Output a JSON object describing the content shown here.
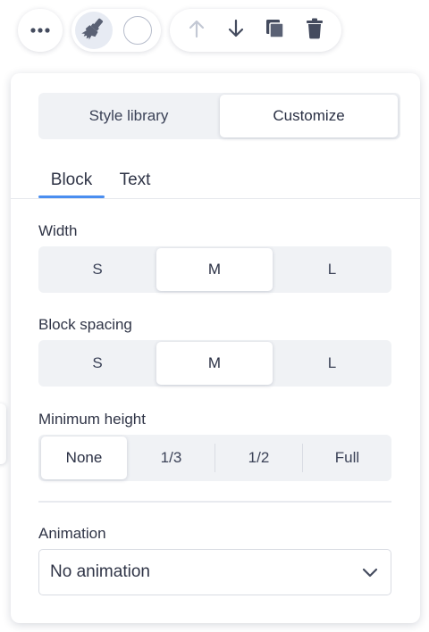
{
  "toolbar": {
    "more_icon": "more-horizontal-icon",
    "style_icon": "paintbrush-icon",
    "color_icon": "color-circle",
    "actions": [
      "arrow-up-icon",
      "arrow-down-icon",
      "duplicate-icon",
      "trash-icon"
    ]
  },
  "panel": {
    "mode_toggle": {
      "style_library": "Style library",
      "customize": "Customize",
      "selected": "Customize"
    },
    "tabs": {
      "block": "Block",
      "text": "Text",
      "active": "Block"
    },
    "width": {
      "label": "Width",
      "options": [
        "S",
        "M",
        "L"
      ],
      "selected": "M"
    },
    "block_spacing": {
      "label": "Block spacing",
      "options": [
        "S",
        "M",
        "L"
      ],
      "selected": "M"
    },
    "minimum_height": {
      "label": "Minimum height",
      "options": [
        "None",
        "1/3",
        "1/2",
        "Full"
      ],
      "selected": "None"
    },
    "animation": {
      "label": "Animation",
      "value": "No animation"
    }
  },
  "colors": {
    "accent": "#4a8ef0",
    "panel_bg": "#ffffff",
    "segment_bg": "#f0f2f5",
    "text": "#2f3446",
    "icon": "#444b5e",
    "icon_disabled": "#c3c8d4"
  }
}
